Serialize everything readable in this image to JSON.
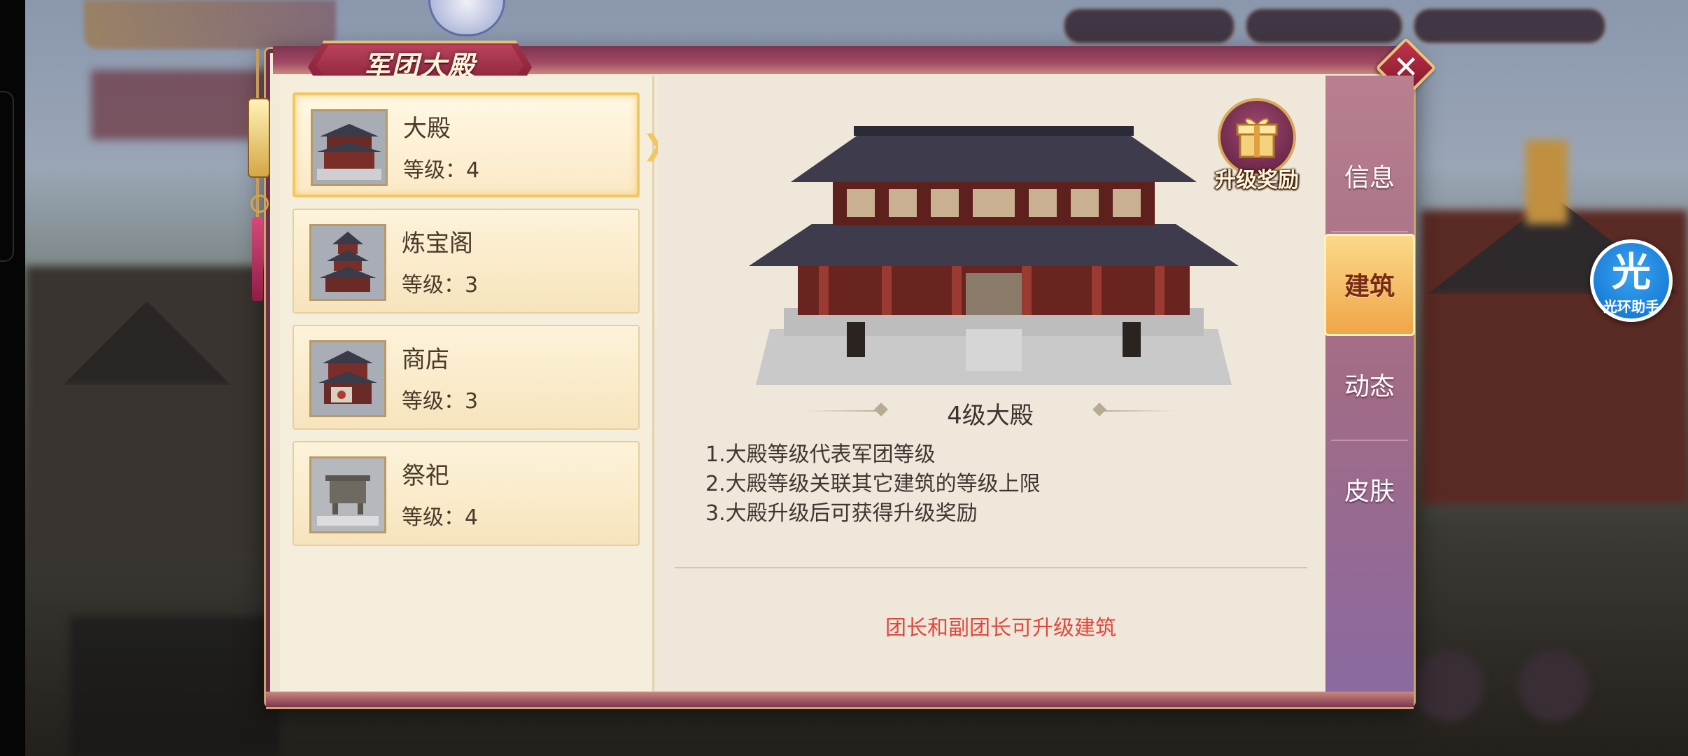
{
  "panel": {
    "title": "军团大殿",
    "close_icon": "close-icon"
  },
  "buildings": [
    {
      "name": "大殿",
      "level_label": "等级：4",
      "selected": true
    },
    {
      "name": "炼宝阁",
      "level_label": "等级：3",
      "selected": false
    },
    {
      "name": "商店",
      "level_label": "等级：3",
      "selected": false
    },
    {
      "name": "祭祀",
      "level_label": "等级：4",
      "selected": false
    }
  ],
  "detail": {
    "level_title": "4级大殿",
    "reward_label": "升级奖励",
    "reward_icon": "gift-icon",
    "descriptions": [
      "1.大殿等级代表军团等级",
      "2.大殿等级关联其它建筑的等级上限",
      "3.大殿升级后可获得升级奖励"
    ],
    "notice": "团长和副团长可升级建筑",
    "notice_color": "#e2473e"
  },
  "tabs": [
    {
      "label": "信息",
      "active": false
    },
    {
      "label": "建筑",
      "active": true
    },
    {
      "label": "动态",
      "active": false
    },
    {
      "label": "皮肤",
      "active": false
    }
  ],
  "helper": {
    "glyph": "光",
    "label": "光环助手"
  },
  "colors": {
    "frame": "#6e3046",
    "gold": "#c8a56a",
    "active_tab": "#f2b858"
  }
}
